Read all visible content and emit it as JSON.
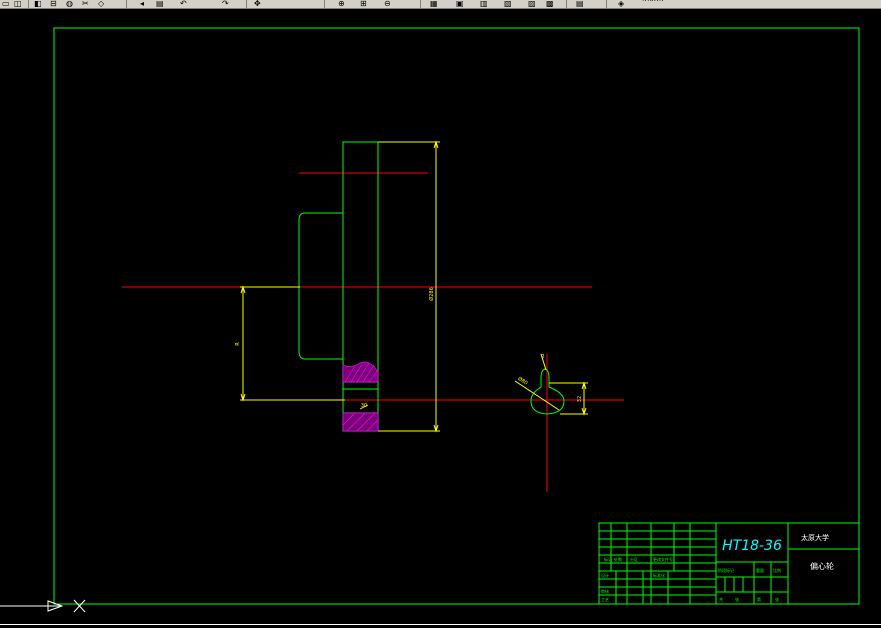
{
  "toolbar": {
    "icons": [
      "new-icon",
      "open-icon",
      "save-icon",
      "print-icon",
      "preview-icon",
      "cut-icon",
      "copy-icon",
      "paste-icon",
      "match-icon",
      "undo-icon",
      "redo-icon",
      "pan-icon",
      "zoom-realtime-icon",
      "zoom-window-icon",
      "zoom-previous-icon",
      "properties-icon",
      "design-center-icon",
      "tool-palettes-icon",
      "sheet-set-icon",
      "markup-icon",
      "calculator-icon"
    ],
    "layer_text": "’‘’“‘‘’‘"
  },
  "title_block": {
    "material": "HT18-36",
    "company": "太原大学",
    "part_name": "偏心轮",
    "fields": {
      "f1": "标记",
      "f2": "处数",
      "f3": "分区",
      "f4": "更改文件号",
      "f5": "设计",
      "f6": "审核",
      "f7": "工艺",
      "f8": "标准化",
      "f9": "阶段标记",
      "f10": "重量",
      "f11": "比例",
      "f12": "共",
      "f13": "张",
      "f14": "第",
      "f15": "张"
    }
  },
  "dimensions": {
    "main_height": "Ø286",
    "offset": "R",
    "keyway": "30",
    "hole_small": "2",
    "hub_angle": "Ø400",
    "side_view_width": "32",
    "side_view_radius": "Ø80"
  },
  "colors": {
    "background": "#000000",
    "border": "#00ff00",
    "centerline": "#ff0000",
    "dimension": "#ffff00",
    "hatch": "#ff00ff",
    "ucs": "#ffffff"
  }
}
